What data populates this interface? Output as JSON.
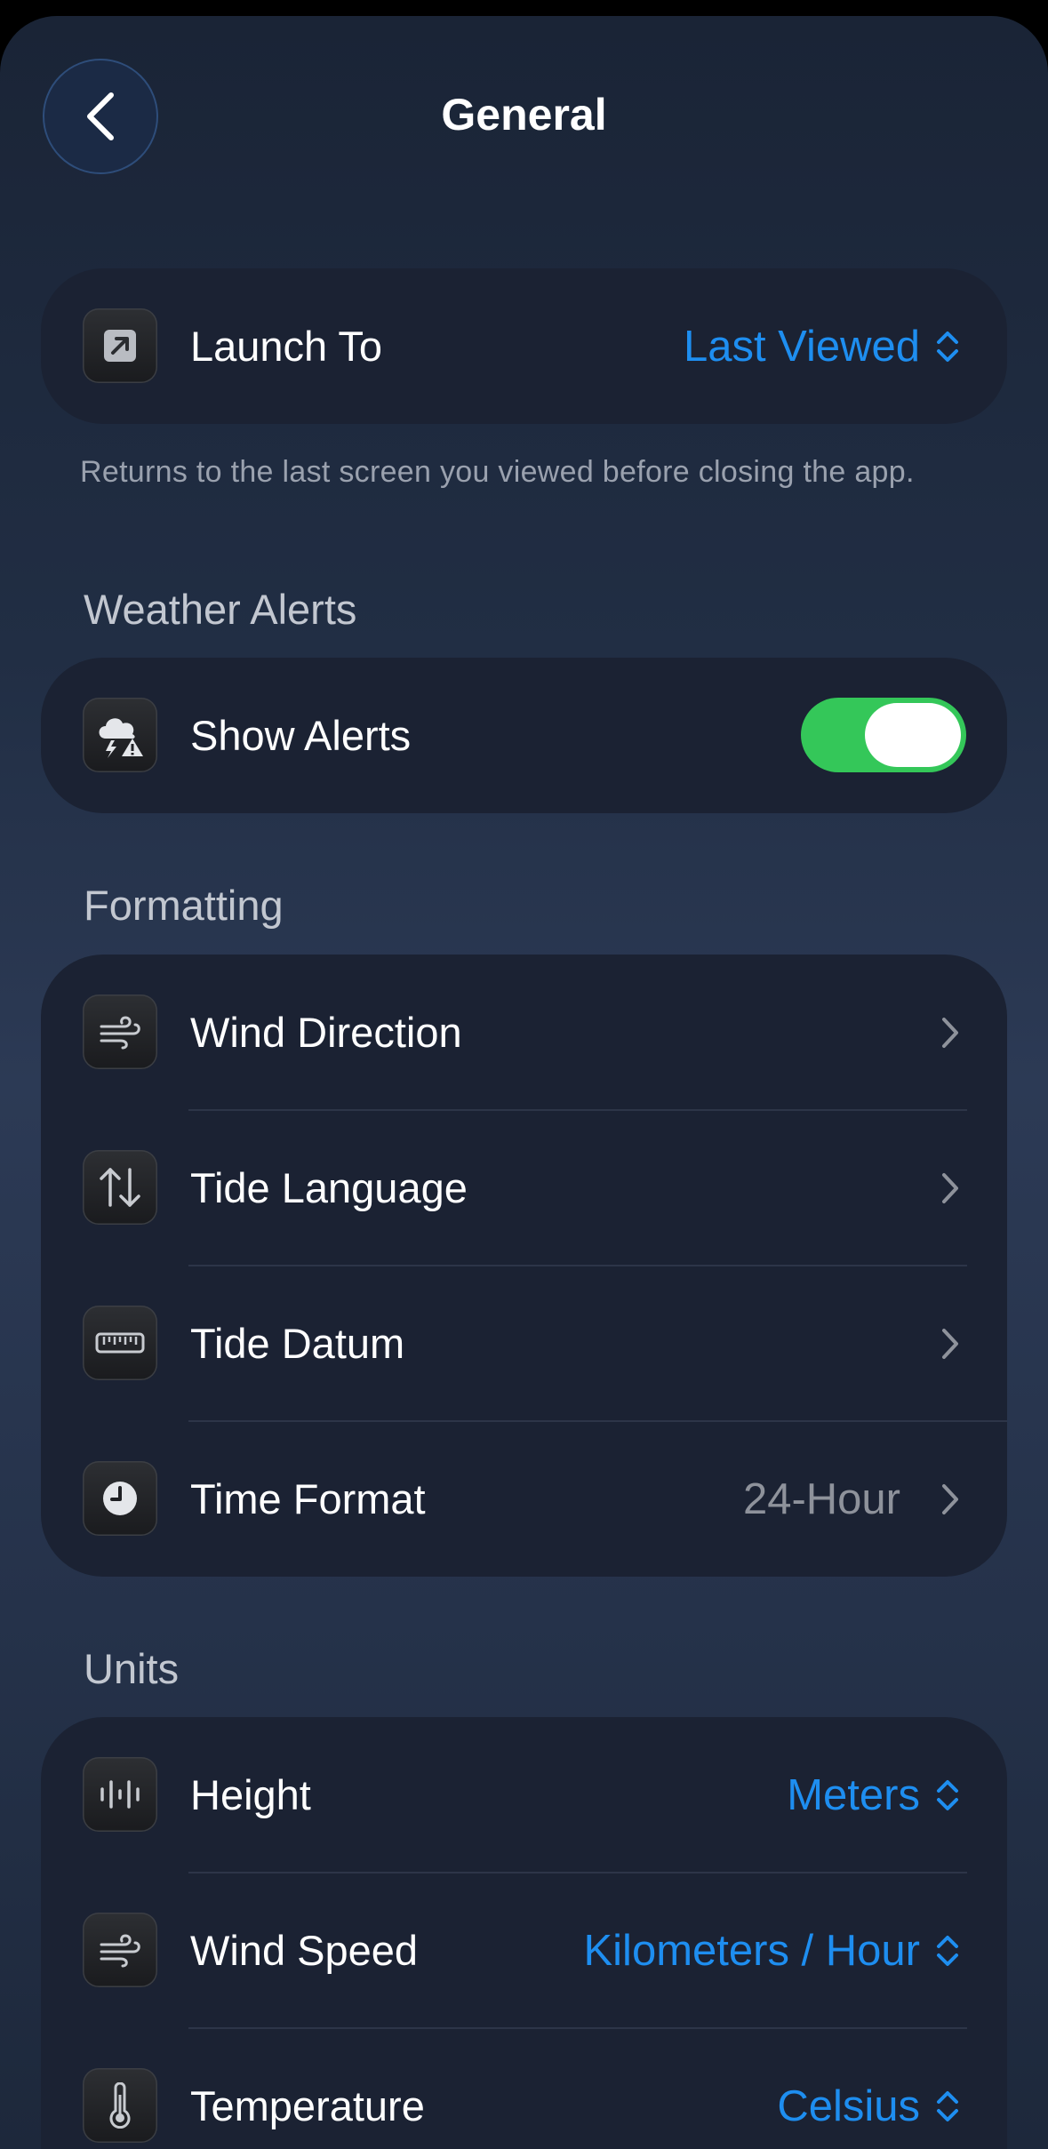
{
  "header": {
    "title": "General"
  },
  "launch": {
    "label": "Launch To",
    "value": "Last Viewed",
    "footnote": "Returns to the last screen you viewed before closing the app."
  },
  "weather_alerts": {
    "header": "Weather Alerts",
    "show_alerts": {
      "label": "Show Alerts",
      "enabled": true
    }
  },
  "formatting": {
    "header": "Formatting",
    "items": [
      {
        "label": "Wind Direction",
        "icon": "wind-icon"
      },
      {
        "label": "Tide Language",
        "icon": "arrows-up-down-icon"
      },
      {
        "label": "Tide Datum",
        "icon": "ruler-icon"
      },
      {
        "label": "Time Format",
        "icon": "clock-icon",
        "value": "24-Hour"
      }
    ]
  },
  "units": {
    "header": "Units",
    "items": [
      {
        "label": "Height",
        "icon": "waveform-icon",
        "value": "Meters"
      },
      {
        "label": "Wind Speed",
        "icon": "wind-icon",
        "value": "Kilometers / Hour"
      },
      {
        "label": "Temperature",
        "icon": "thermometer-icon",
        "value": "Celsius"
      }
    ]
  },
  "colors": {
    "accent": "#1e8ef0",
    "toggle_on": "#34c759",
    "secondary_text": "#8e929b"
  }
}
